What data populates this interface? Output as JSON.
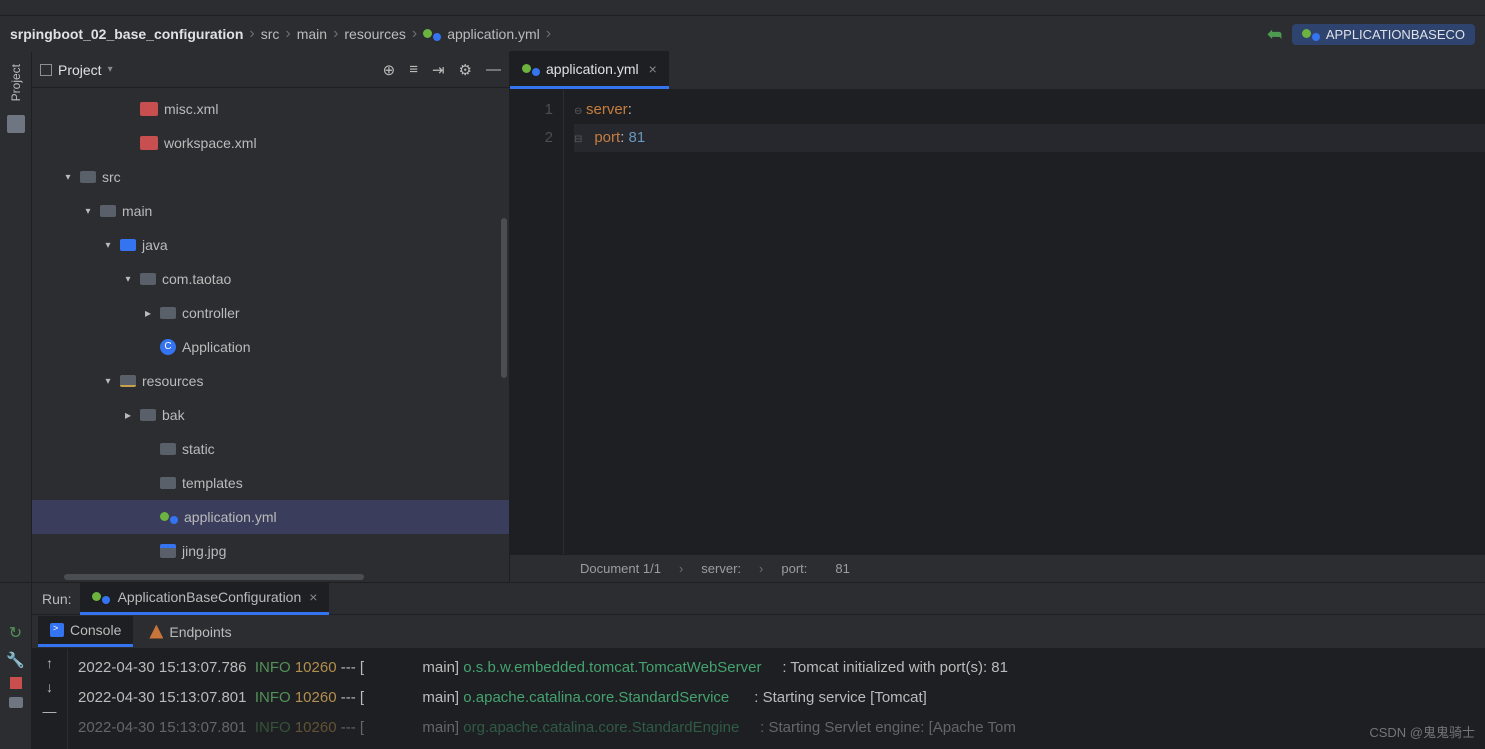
{
  "breadcrumb": {
    "root": "srpingboot_02_base_configuration",
    "parts": [
      "src",
      "main",
      "resources",
      "application.yml"
    ]
  },
  "topRight": {
    "runConfig": "APPLICATIONBASECO"
  },
  "projectPanel": {
    "title": "Project",
    "tree": [
      {
        "indent": 4,
        "chev": "none",
        "iconType": "xml",
        "iconText": "",
        "label": "misc.xml",
        "name": "file-misc-xml"
      },
      {
        "indent": 4,
        "chev": "none",
        "iconType": "xml",
        "iconText": "",
        "label": "workspace.xml",
        "name": "file-workspace-xml"
      },
      {
        "indent": 1,
        "chev": "down",
        "iconType": "folder",
        "iconText": "",
        "label": "src",
        "name": "folder-src"
      },
      {
        "indent": 2,
        "chev": "down",
        "iconType": "folder",
        "iconText": "",
        "label": "main",
        "name": "folder-main"
      },
      {
        "indent": 3,
        "chev": "down",
        "iconType": "folder-blue",
        "iconText": "",
        "label": "java",
        "name": "folder-java"
      },
      {
        "indent": 4,
        "chev": "down",
        "iconType": "pkg",
        "iconText": "",
        "label": "com.taotao",
        "name": "package-com-taotao"
      },
      {
        "indent": 5,
        "chev": "right",
        "iconType": "pkg",
        "iconText": "",
        "label": "controller",
        "name": "package-controller"
      },
      {
        "indent": 5,
        "chev": "none",
        "iconType": "class",
        "iconText": "C",
        "label": "Application",
        "name": "class-application"
      },
      {
        "indent": 3,
        "chev": "down",
        "iconType": "folder-res",
        "iconText": "",
        "label": "resources",
        "name": "folder-resources"
      },
      {
        "indent": 4,
        "chev": "right",
        "iconType": "folder",
        "iconText": "",
        "label": "bak",
        "name": "folder-bak"
      },
      {
        "indent": 5,
        "chev": "none",
        "iconType": "folder",
        "iconText": "",
        "label": "static",
        "name": "folder-static"
      },
      {
        "indent": 5,
        "chev": "none",
        "iconType": "folder",
        "iconText": "",
        "label": "templates",
        "name": "folder-templates"
      },
      {
        "indent": 5,
        "chev": "none",
        "iconType": "yml",
        "iconText": "",
        "label": "application.yml",
        "name": "file-application-yml",
        "selected": true
      },
      {
        "indent": 5,
        "chev": "none",
        "iconType": "img",
        "iconText": "",
        "label": "jing.jpg",
        "name": "file-jing-jpg"
      }
    ]
  },
  "leftRail": {
    "projectLabel": "Project"
  },
  "editor": {
    "tabLabel": "application.yml",
    "lines": [
      {
        "num": "1",
        "key": "server",
        "val": "",
        "active": false
      },
      {
        "num": "2",
        "indent": "  ",
        "key": "port",
        "val": " 81",
        "active": true
      }
    ]
  },
  "statusBar": {
    "doc": "Document 1/1",
    "path": [
      "server:",
      "port:"
    ],
    "value": "81"
  },
  "runPanel": {
    "label": "Run:",
    "runTab": "ApplicationBaseConfiguration",
    "consoleTab": "Console",
    "endpointsTab": "Endpoints",
    "log": [
      {
        "ts": "2022-04-30 15:13:07.786",
        "lvl": "INFO",
        "pid": "10260",
        "thread": "main",
        "cls": "o.s.b.w.embedded.tomcat.TomcatWebServer",
        "msg": "Tomcat initialized with port(s): 81",
        "dim": false
      },
      {
        "ts": "2022-04-30 15:13:07.801",
        "lvl": "INFO",
        "pid": "10260",
        "thread": "main",
        "cls": "o.apache.catalina.core.StandardService",
        "msg": "Starting service [Tomcat]",
        "dim": false
      },
      {
        "ts": "2022-04-30 15:13:07.801",
        "lvl": "INFO",
        "pid": "10260",
        "thread": "main",
        "cls": "org.apache.catalina.core.StandardEngine",
        "msg": "Starting Servlet engine: [Apache Tom",
        "dim": true
      }
    ]
  },
  "watermark": "CSDN @鬼鬼骑士"
}
